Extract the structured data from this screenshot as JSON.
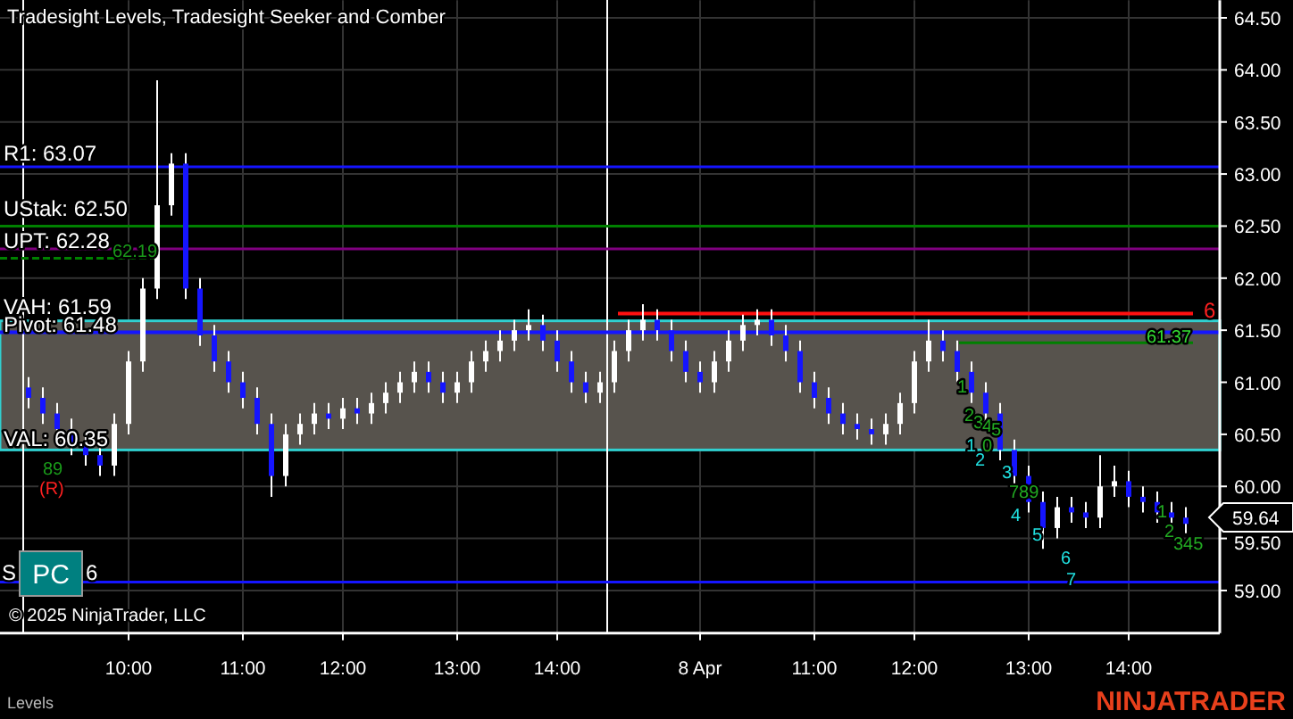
{
  "chart_title": "Tradesight Levels, Tradesight Seeker and Comber",
  "current_price": "59.64",
  "chart_data": {
    "type": "candlestick",
    "yticks": [
      {
        "value": 64.5,
        "label": "64.50"
      },
      {
        "value": 64,
        "label": "64.00"
      },
      {
        "value": 63.5,
        "label": "63.50"
      },
      {
        "value": 63,
        "label": "63.00"
      },
      {
        "value": 62.5,
        "label": "62.50"
      },
      {
        "value": 62,
        "label": "62.00"
      },
      {
        "value": 61.5,
        "label": "61.50"
      },
      {
        "value": 61,
        "label": "61.00"
      },
      {
        "value": 60.5,
        "label": "60.50"
      },
      {
        "value": 60,
        "label": "60.00"
      },
      {
        "value": 59.5,
        "label": "59.50"
      },
      {
        "value": 59,
        "label": "59.00"
      }
    ],
    "ylim": [
      58.59,
      64.67
    ],
    "categories": [
      null,
      null,
      null,
      null,
      null,
      null,
      null,
      "10:00",
      null,
      null,
      null,
      null,
      null,
      null,
      null,
      "11:00",
      null,
      null,
      null,
      null,
      null,
      null,
      "12:00",
      null,
      null,
      null,
      null,
      null,
      null,
      null,
      "13:00",
      null,
      null,
      null,
      null,
      null,
      null,
      "14:00",
      null,
      null,
      null,
      null,
      null,
      null,
      null,
      null,
      null,
      "8 Apr",
      null,
      null,
      null,
      null,
      null,
      null,
      null,
      "11:00",
      null,
      null,
      null,
      null,
      null,
      null,
      "12:00",
      null,
      null,
      null,
      null,
      null,
      null,
      null,
      "13:00",
      null,
      null,
      null,
      null,
      null,
      null,
      "14:00",
      null,
      null,
      null,
      null
    ],
    "ohlc": [
      [
        60.95,
        61.05,
        60.75,
        60.85
      ],
      [
        60.85,
        60.95,
        60.6,
        60.7
      ],
      [
        60.7,
        60.8,
        60.45,
        60.55
      ],
      [
        60.55,
        60.65,
        60.3,
        60.4
      ],
      [
        60.4,
        60.5,
        60.2,
        60.3
      ],
      [
        60.3,
        60.4,
        60.1,
        60.2
      ],
      [
        60.2,
        60.7,
        60.1,
        60.6
      ],
      [
        60.6,
        61.3,
        60.5,
        61.2
      ],
      [
        61.2,
        62.0,
        61.1,
        61.9
      ],
      [
        61.9,
        63.9,
        61.8,
        62.7
      ],
      [
        62.7,
        63.2,
        62.6,
        63.1
      ],
      [
        63.1,
        63.2,
        61.8,
        61.9
      ],
      [
        61.9,
        62.0,
        61.35,
        61.45
      ],
      [
        61.45,
        61.55,
        61.1,
        61.2
      ],
      [
        61.2,
        61.3,
        60.9,
        61.0
      ],
      [
        61.0,
        61.1,
        60.75,
        60.85
      ],
      [
        60.85,
        60.95,
        60.5,
        60.6
      ],
      [
        60.6,
        60.7,
        59.9,
        60.1
      ],
      [
        60.1,
        60.6,
        60.0,
        60.5
      ],
      [
        60.5,
        60.7,
        60.4,
        60.6
      ],
      [
        60.6,
        60.8,
        60.5,
        60.7
      ],
      [
        60.7,
        60.8,
        60.55,
        60.65
      ],
      [
        60.65,
        60.85,
        60.55,
        60.75
      ],
      [
        60.75,
        60.85,
        60.6,
        60.7
      ],
      [
        60.7,
        60.9,
        60.6,
        60.8
      ],
      [
        60.8,
        61.0,
        60.7,
        60.9
      ],
      [
        60.9,
        61.1,
        60.8,
        61.0
      ],
      [
        61.0,
        61.2,
        60.9,
        61.1
      ],
      [
        61.1,
        61.2,
        60.9,
        61.0
      ],
      [
        61.0,
        61.1,
        60.8,
        60.9
      ],
      [
        60.9,
        61.1,
        60.8,
        61.0
      ],
      [
        61.0,
        61.3,
        60.9,
        61.2
      ],
      [
        61.2,
        61.4,
        61.1,
        61.3
      ],
      [
        61.3,
        61.5,
        61.2,
        61.4
      ],
      [
        61.4,
        61.6,
        61.3,
        61.5
      ],
      [
        61.5,
        61.7,
        61.4,
        61.55
      ],
      [
        61.55,
        61.65,
        61.3,
        61.4
      ],
      [
        61.4,
        61.5,
        61.1,
        61.2
      ],
      [
        61.2,
        61.3,
        60.9,
        61.0
      ],
      [
        61.0,
        61.1,
        60.8,
        60.9
      ],
      [
        60.9,
        61.1,
        60.8,
        61.0
      ],
      [
        61.0,
        61.4,
        60.9,
        61.3
      ],
      [
        61.3,
        61.6,
        61.2,
        61.5
      ],
      [
        61.5,
        61.75,
        61.4,
        61.6
      ],
      [
        61.6,
        61.7,
        61.4,
        61.5
      ],
      [
        61.5,
        61.6,
        61.2,
        61.3
      ],
      [
        61.3,
        61.4,
        61.0,
        61.1
      ],
      [
        61.1,
        61.2,
        60.9,
        61.0
      ],
      [
        61.0,
        61.3,
        60.9,
        61.2
      ],
      [
        61.2,
        61.5,
        61.1,
        61.4
      ],
      [
        61.4,
        61.65,
        61.3,
        61.55
      ],
      [
        61.55,
        61.7,
        61.45,
        61.6
      ],
      [
        61.6,
        61.7,
        61.35,
        61.45
      ],
      [
        61.45,
        61.55,
        61.2,
        61.3
      ],
      [
        61.3,
        61.4,
        60.9,
        61.0
      ],
      [
        61.0,
        61.1,
        60.75,
        60.85
      ],
      [
        60.85,
        60.95,
        60.6,
        60.7
      ],
      [
        60.7,
        60.8,
        60.5,
        60.6
      ],
      [
        60.6,
        60.7,
        60.45,
        60.55
      ],
      [
        60.55,
        60.65,
        60.4,
        60.5
      ],
      [
        60.5,
        60.7,
        60.4,
        60.6
      ],
      [
        60.6,
        60.9,
        60.5,
        60.8
      ],
      [
        60.8,
        61.3,
        60.7,
        61.2
      ],
      [
        61.2,
        61.6,
        61.1,
        61.4
      ],
      [
        61.4,
        61.5,
        61.2,
        61.3
      ],
      [
        61.3,
        61.4,
        61.0,
        61.1
      ],
      [
        61.1,
        61.2,
        60.8,
        60.9
      ],
      [
        60.9,
        61.0,
        60.6,
        60.7
      ],
      [
        60.7,
        60.8,
        60.25,
        60.35
      ],
      [
        60.35,
        60.45,
        60.0,
        60.1
      ],
      [
        60.1,
        60.2,
        59.75,
        59.85
      ],
      [
        59.85,
        59.95,
        59.4,
        59.6
      ],
      [
        59.6,
        59.9,
        59.5,
        59.8
      ],
      [
        59.8,
        59.9,
        59.65,
        59.75
      ],
      [
        59.75,
        59.85,
        59.6,
        59.7
      ],
      [
        59.7,
        60.3,
        59.6,
        60.0
      ],
      [
        60.0,
        60.2,
        59.9,
        60.05
      ],
      [
        60.05,
        60.15,
        59.8,
        59.9
      ],
      [
        59.9,
        60.0,
        59.75,
        59.85
      ],
      [
        59.85,
        59.95,
        59.65,
        59.75
      ],
      [
        59.75,
        59.85,
        59.6,
        59.7
      ],
      [
        59.7,
        59.8,
        59.55,
        59.64
      ]
    ]
  },
  "level_labels": [
    {
      "text": "R1: 63.07",
      "color": "#ffffff"
    },
    {
      "text": "UStak: 62.50",
      "color": "#ffffff"
    },
    {
      "text": "UPT: 62.28",
      "color": "#ffffff"
    },
    {
      "text": "62.19",
      "color": "#1a9a1a"
    },
    {
      "text": "VAH: 61.59",
      "color": "#ffffff"
    },
    {
      "text": "Pivot: 61.48",
      "color": "#ffffff"
    },
    {
      "text": "VAL: 60.35",
      "color": "#ffffff"
    },
    {
      "text": "61.37",
      "color": "#33dd33"
    },
    {
      "text": "6",
      "color": "#ff2020"
    },
    {
      "text": "S",
      "color": "#ffffff"
    },
    {
      "text": "6",
      "color": "#ffffff"
    }
  ],
  "count_markers": [
    {
      "text": "89",
      "color": "#1a9a1a"
    },
    {
      "text": "(R)",
      "color": "#ff2020"
    },
    {
      "text": "1",
      "color": "#22aa22"
    },
    {
      "text": "2",
      "color": "#22aa22"
    },
    {
      "text": "1",
      "color": "#20e0e0"
    },
    {
      "text": "3",
      "color": "#22aa22"
    },
    {
      "text": "2",
      "color": "#20e0e0"
    },
    {
      "text": "4",
      "color": "#22aa22"
    },
    {
      "text": "5",
      "color": "#22aa22"
    },
    {
      "text": "0",
      "color": "#22aa22"
    },
    {
      "text": "3",
      "color": "#20e0e0"
    },
    {
      "text": "789",
      "color": "#22aa22"
    },
    {
      "text": "4",
      "color": "#20e0e0"
    },
    {
      "text": "5",
      "color": "#20e0e0"
    },
    {
      "text": "6",
      "color": "#20e0e0"
    },
    {
      "text": "7",
      "color": "#20e0e0"
    },
    {
      "text": "1",
      "color": "#22aa22"
    },
    {
      "text": "2",
      "color": "#22aa22"
    },
    {
      "text": "345",
      "color": "#22aa22"
    }
  ],
  "pc_button": "PC",
  "copyright": "© 2025 NinjaTrader, LLC",
  "indicator_legend": "Levels",
  "logo": "NINJATRADER"
}
